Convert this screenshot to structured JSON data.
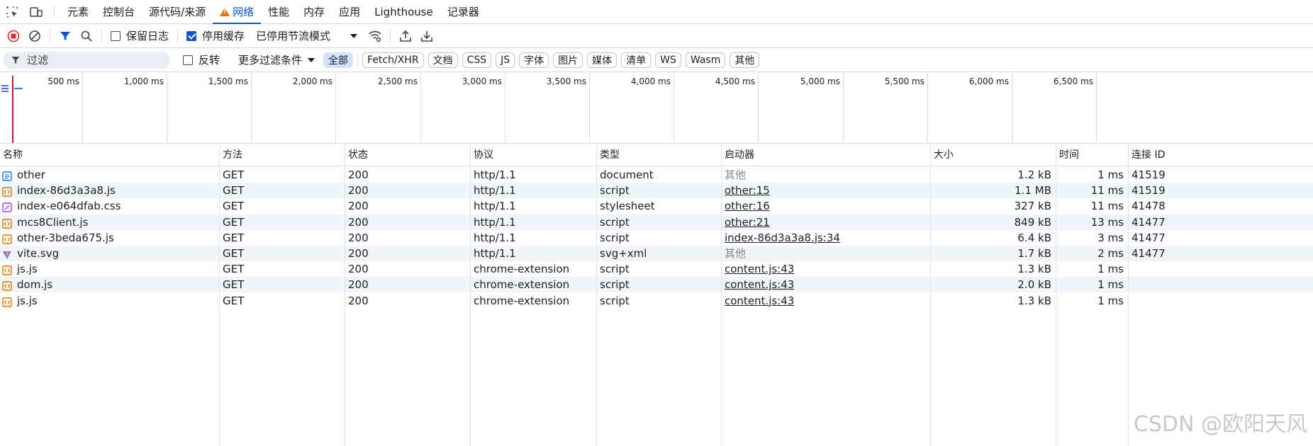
{
  "tabs": [
    {
      "label": "元素",
      "active": false
    },
    {
      "label": "控制台",
      "active": false
    },
    {
      "label": "源代码/来源",
      "active": false
    },
    {
      "label": "网络",
      "active": true
    },
    {
      "label": "性能",
      "active": false
    },
    {
      "label": "内存",
      "active": false
    },
    {
      "label": "应用",
      "active": false
    },
    {
      "label": "Lighthouse",
      "active": false
    },
    {
      "label": "记录器",
      "active": false
    }
  ],
  "toolbar": {
    "preserve_log_label": "保留日志",
    "preserve_log_checked": false,
    "disable_cache_label": "停用缓存",
    "disable_cache_checked": true,
    "throttle_value": "已停用节流模式"
  },
  "filter": {
    "placeholder": "过滤",
    "invert_label": "反转",
    "invert_checked": false,
    "more_filters_label": "更多过滤条件",
    "type_pills": [
      "全部",
      "Fetch/XHR",
      "文档",
      "CSS",
      "JS",
      "字体",
      "图片",
      "媒体",
      "清单",
      "WS",
      "Wasm",
      "其他"
    ],
    "active_pill": "全部"
  },
  "overview": {
    "ticks": [
      "500 ms",
      "1,000 ms",
      "1,500 ms",
      "2,000 ms",
      "2,500 ms",
      "3,000 ms",
      "3,500 ms",
      "4,000 ms",
      "4,500 ms",
      "5,000 ms",
      "5,500 ms",
      "6,000 ms",
      "6,500 ms"
    ]
  },
  "table": {
    "headers": {
      "name": "名称",
      "method": "方法",
      "status": "状态",
      "protocol": "协议",
      "type": "类型",
      "initiator": "启动器",
      "size": "大小",
      "time": "时间",
      "connection": "连接 ID"
    },
    "rows": [
      {
        "icon": "document-icon",
        "name": "other",
        "method": "GET",
        "status": "200",
        "protocol": "http/1.1",
        "type": "document",
        "initiator": "其他",
        "initiator_link": false,
        "size": "1.2 kB",
        "time": "1 ms",
        "connection": "41519"
      },
      {
        "icon": "script-icon",
        "name": "index-86d3a3a8.js",
        "method": "GET",
        "status": "200",
        "protocol": "http/1.1",
        "type": "script",
        "initiator": "other:15",
        "initiator_link": true,
        "size": "1.1 MB",
        "time": "11 ms",
        "connection": "41519"
      },
      {
        "icon": "stylesheet-icon",
        "name": "index-e064dfab.css",
        "method": "GET",
        "status": "200",
        "protocol": "http/1.1",
        "type": "stylesheet",
        "initiator": "other:16",
        "initiator_link": true,
        "size": "327 kB",
        "time": "11 ms",
        "connection": "41478"
      },
      {
        "icon": "script-icon",
        "name": "mcs8Client.js",
        "method": "GET",
        "status": "200",
        "protocol": "http/1.1",
        "type": "script",
        "initiator": "other:21",
        "initiator_link": true,
        "size": "849 kB",
        "time": "13 ms",
        "connection": "41477"
      },
      {
        "icon": "script-icon",
        "name": "other-3beda675.js",
        "method": "GET",
        "status": "200",
        "protocol": "http/1.1",
        "type": "script",
        "initiator": "index-86d3a3a8.js:34",
        "initiator_link": true,
        "size": "6.4 kB",
        "time": "3 ms",
        "connection": "41477"
      },
      {
        "icon": "vite-icon",
        "name": "vite.svg",
        "method": "GET",
        "status": "200",
        "protocol": "http/1.1",
        "type": "svg+xml",
        "initiator": "其他",
        "initiator_link": false,
        "size": "1.7 kB",
        "time": "2 ms",
        "connection": "41477"
      },
      {
        "icon": "script-icon",
        "name": "js.js",
        "method": "GET",
        "status": "200",
        "protocol": "chrome-extension",
        "type": "script",
        "initiator": "content.js:43",
        "initiator_link": true,
        "size": "1.3 kB",
        "time": "1 ms",
        "connection": ""
      },
      {
        "icon": "script-icon",
        "name": "dom.js",
        "method": "GET",
        "status": "200",
        "protocol": "chrome-extension",
        "type": "script",
        "initiator": "content.js:43",
        "initiator_link": true,
        "size": "2.0 kB",
        "time": "1 ms",
        "connection": ""
      },
      {
        "icon": "script-icon",
        "name": "js.js",
        "method": "GET",
        "status": "200",
        "protocol": "chrome-extension",
        "type": "script",
        "initiator": "content.js:43",
        "initiator_link": true,
        "size": "1.3 kB",
        "time": "1 ms",
        "connection": ""
      }
    ]
  },
  "watermark": "CSDN @欧阳天风",
  "colors": {
    "accent": "#0b57d0",
    "record": "#d93025",
    "warning": "#e8710a",
    "row_alt": "#f1f4f9"
  }
}
